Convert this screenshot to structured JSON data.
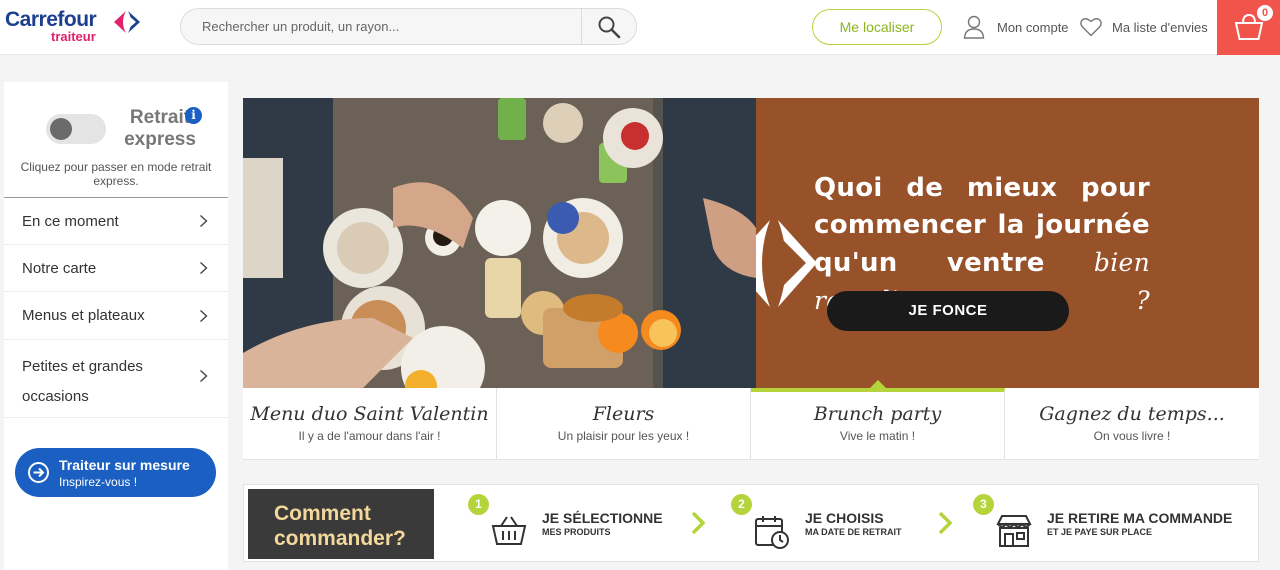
{
  "header": {
    "logo_brand": "Carrefour",
    "logo_sub": "traiteur",
    "search_placeholder": "Rechercher un produit, un rayon...",
    "locate_label": "Me localiser",
    "account_label": "Mon compte",
    "wishlist_label": "Ma liste d'envies",
    "cart_count": "0",
    "icons": [
      "search-icon",
      "user-icon",
      "heart-icon",
      "basket-icon"
    ]
  },
  "sidebar": {
    "retrait_title": "Retrait express",
    "retrait_info": "i",
    "retrait_desc": "Cliquez pour passer en mode retrait express.",
    "toggle_on": false,
    "menu": [
      {
        "label": "En ce moment"
      },
      {
        "label": "Notre carte"
      },
      {
        "label": "Menus et plateaux"
      },
      {
        "label": "Petites et grandes occasions"
      }
    ],
    "mesure_title": "Traiteur sur mesure",
    "mesure_sub": "Inspirez-vous !"
  },
  "hero": {
    "line1": "Quoi de mieux pour",
    "line2": "commencer la journée",
    "line3": "qu'un ventre",
    "line3_script": "bien rempli",
    "line3_end": " ?",
    "cta": "JE FONCE"
  },
  "tabs": [
    {
      "title": "Menu duo Saint Valentin",
      "sub": "Il y a de l'amour dans l'air !",
      "active": false
    },
    {
      "title": "Fleurs",
      "sub": "Un plaisir pour les yeux !",
      "active": false
    },
    {
      "title": "Brunch party",
      "sub": "Vive le matin !",
      "active": true
    },
    {
      "title": "Gagnez du temps...",
      "sub": "On vous livre !",
      "active": false
    }
  ],
  "how": {
    "title_line1": "Comment",
    "title_line2": "commander?",
    "steps": [
      {
        "num": "1",
        "title": "JE SÉLECTIONNE",
        "sub": "MES PRODUITS",
        "icon": "basket-icon"
      },
      {
        "num": "2",
        "title": "JE CHOISIS",
        "sub": "MA DATE DE RETRAIT",
        "icon": "calendar-clock-icon"
      },
      {
        "num": "3",
        "title": "JE RETIRE MA COMMANDE",
        "sub": "ET JE PAYE SUR PLACE",
        "icon": "store-icon"
      }
    ]
  },
  "colors": {
    "brand_blue": "#1d3f8f",
    "brand_pink": "#e2206b",
    "accent_green": "#b5d33b",
    "cart_red": "#f0544a",
    "hero_brown": "#98522a",
    "button_blue": "#1a5fc1"
  }
}
